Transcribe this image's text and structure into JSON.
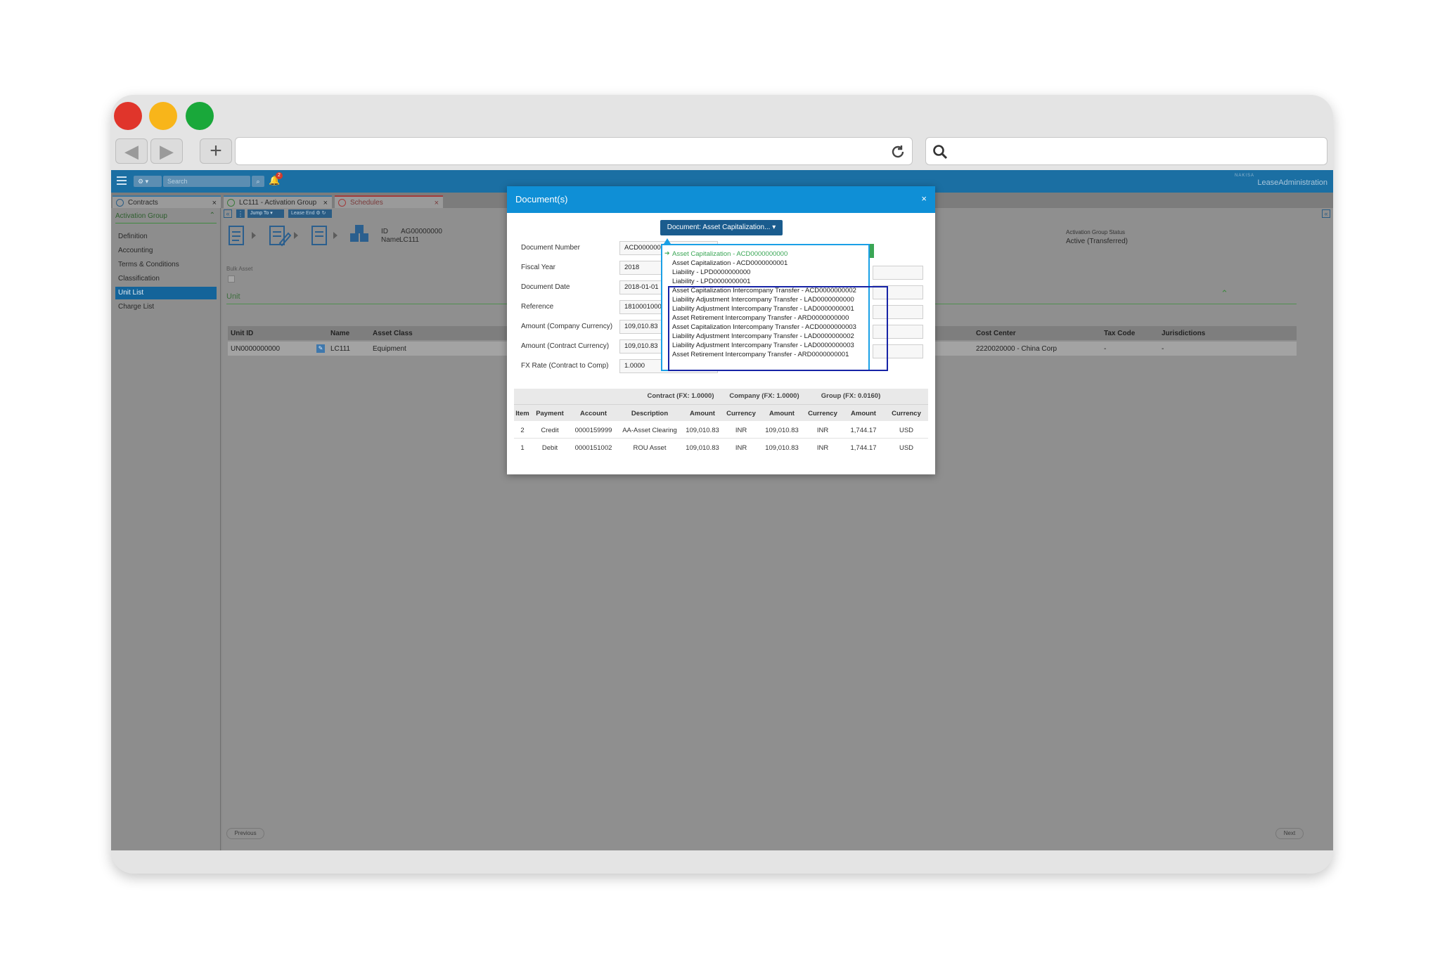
{
  "browser": {
    "traffic_lights": [
      "#e0352b",
      "#f8b51a",
      "#19a83a"
    ],
    "back_icon": "left-arrow-icon",
    "forward_icon": "right-arrow-icon",
    "new_tab_icon": "plus-icon",
    "reload_icon": "reload-icon",
    "search_icon": "magnifier-icon"
  },
  "app": {
    "search_placeholder": "Search",
    "notification_count": "2",
    "brand_small": "NAKISA",
    "brand": "LeaseAdministration",
    "tabs": [
      {
        "label": "Contracts"
      },
      {
        "label": "LC111 - Activation Group"
      },
      {
        "label": "Schedules"
      }
    ],
    "sidebar": {
      "header": "Activation Group",
      "items": [
        "Definition",
        "Accounting",
        "Terms & Conditions",
        "Classification",
        "Unit List",
        "Charge List"
      ],
      "active_index": 4
    },
    "toolbar": {
      "jump_to": "Jump To",
      "lease_end": "Lease End"
    },
    "info": {
      "id_label": "ID",
      "id_value": "AG00000000",
      "name_label": "Name",
      "name_value": "LC111"
    },
    "status": {
      "label": "Activation Group Status",
      "value": "Active (Transferred)"
    },
    "bulk_asset": "Bulk Asset",
    "section_title": "Unit",
    "unit_table": {
      "headers": [
        "Unit ID",
        "Name",
        "Asset Class",
        "Cost Center",
        "Tax Code",
        "Jurisdictions"
      ],
      "row": {
        "unit_id": "UN0000000000",
        "name": "LC111",
        "asset_class": "Equipment",
        "cost_center": "2220020000 - China Corp",
        "tax_code": "-",
        "jurisdictions": "-"
      }
    },
    "footer": {
      "previous": "Previous",
      "next": "Next"
    }
  },
  "modal": {
    "title": "Document(s)",
    "close": "×",
    "doc_button": "Document: Asset Capitalization...",
    "fields": [
      {
        "label": "Document Number",
        "value": "ACD000000"
      },
      {
        "label": "Fiscal Year",
        "value": "2018"
      },
      {
        "label": "Document Date",
        "value": "2018-01-01"
      },
      {
        "label": "Reference",
        "value": "1810001000"
      },
      {
        "label": "Amount (Company Currency)",
        "value": "109,010.83"
      },
      {
        "label": "Amount (Contract Currency)",
        "value": "109,010.83"
      },
      {
        "label": "FX Rate (Contract to Comp)",
        "value": "1.0000"
      }
    ],
    "dropdown": [
      "Asset Capitalization - ACD0000000000",
      "Asset Capitalization - ACD0000000001",
      "Liability - LPD0000000000",
      "Liability - LPD0000000001",
      "Asset Capitalization Intercompany Transfer - ACD0000000002",
      "Liability Adjustment Intercompany Transfer - LAD0000000000",
      "Liability Adjustment Intercompany Transfer - LAD0000000001",
      "Asset Retirement Intercompany Transfer - ARD0000000000",
      "Asset Capitalization Intercompany Transfer - ACD0000000003",
      "Liability Adjustment Intercompany Transfer - LAD0000000002",
      "Liability Adjustment Intercompany Transfer - LAD0000000003",
      "Asset Retirement Intercompany Transfer - ARD0000000001"
    ],
    "selected_index": 0,
    "selected_color": "#3aa655",
    "group_headers": [
      "Contract (FX: 1.0000)",
      "Company (FX: 1.0000)",
      "Group (FX: 0.0160)"
    ],
    "col_headers": [
      "Item",
      "Payment",
      "Account",
      "Description",
      "Amount",
      "Currency",
      "Amount",
      "Currency",
      "Amount",
      "Currency"
    ],
    "rows": [
      [
        "2",
        "Credit",
        "0000159999",
        "AA-Asset Clearing",
        "109,010.83",
        "INR",
        "109,010.83",
        "INR",
        "1,744.17",
        "USD"
      ],
      [
        "1",
        "Debit",
        "0000151002",
        "ROU Asset",
        "109,010.83",
        "INR",
        "109,010.83",
        "INR",
        "1,744.17",
        "USD"
      ]
    ]
  }
}
